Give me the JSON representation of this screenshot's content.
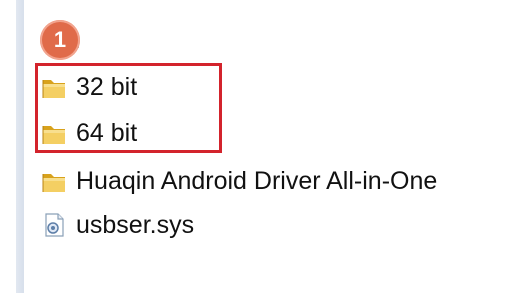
{
  "explorer": {
    "parent_label": ".",
    "items": [
      {
        "label": "32 bit",
        "icon": "folder-icon"
      },
      {
        "label": "64 bit",
        "icon": "folder-icon"
      },
      {
        "label": "Huaqin Android Driver All-in-One",
        "icon": "folder-icon"
      },
      {
        "label": "usbser.sys",
        "icon": "system-file-icon"
      }
    ]
  },
  "annotation": {
    "step_number": "1",
    "badge_color": "#e06b4a",
    "highlight_color": "#d3232c"
  }
}
